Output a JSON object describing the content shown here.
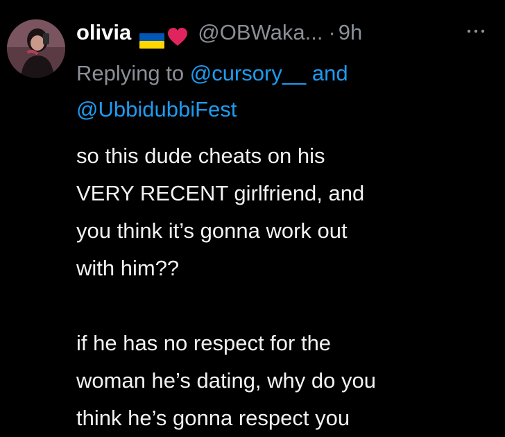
{
  "tweet": {
    "display_name": "olivia",
    "flag_icon": "ukraine-flag-icon",
    "heart_icon": "red-heart-icon",
    "handle": "@OBWaka...",
    "separator": "·",
    "time": "9h",
    "more_icon": "more-horizontal-icon",
    "reply_prefix": "Replying to ",
    "mention_1": "@cursory__",
    "reply_joiner": " and",
    "mention_2": "@UbbidubbiFest",
    "body_paragraph_1": "so this dude cheats on his\nVERY RECENT girlfriend, and\nyou think it’s gonna work out\nwith him??",
    "body_paragraph_2": "if he has no respect for the\nwoman he’s dating, why do you\nthink he’s gonna respect you"
  },
  "colors": {
    "background": "#000000",
    "text": "#f2f2f2",
    "secondary": "#8b9097",
    "link": "#1d9bf0",
    "heart": "#e0245e",
    "flag_blue": "#0057b7",
    "flag_yellow": "#ffd700"
  }
}
